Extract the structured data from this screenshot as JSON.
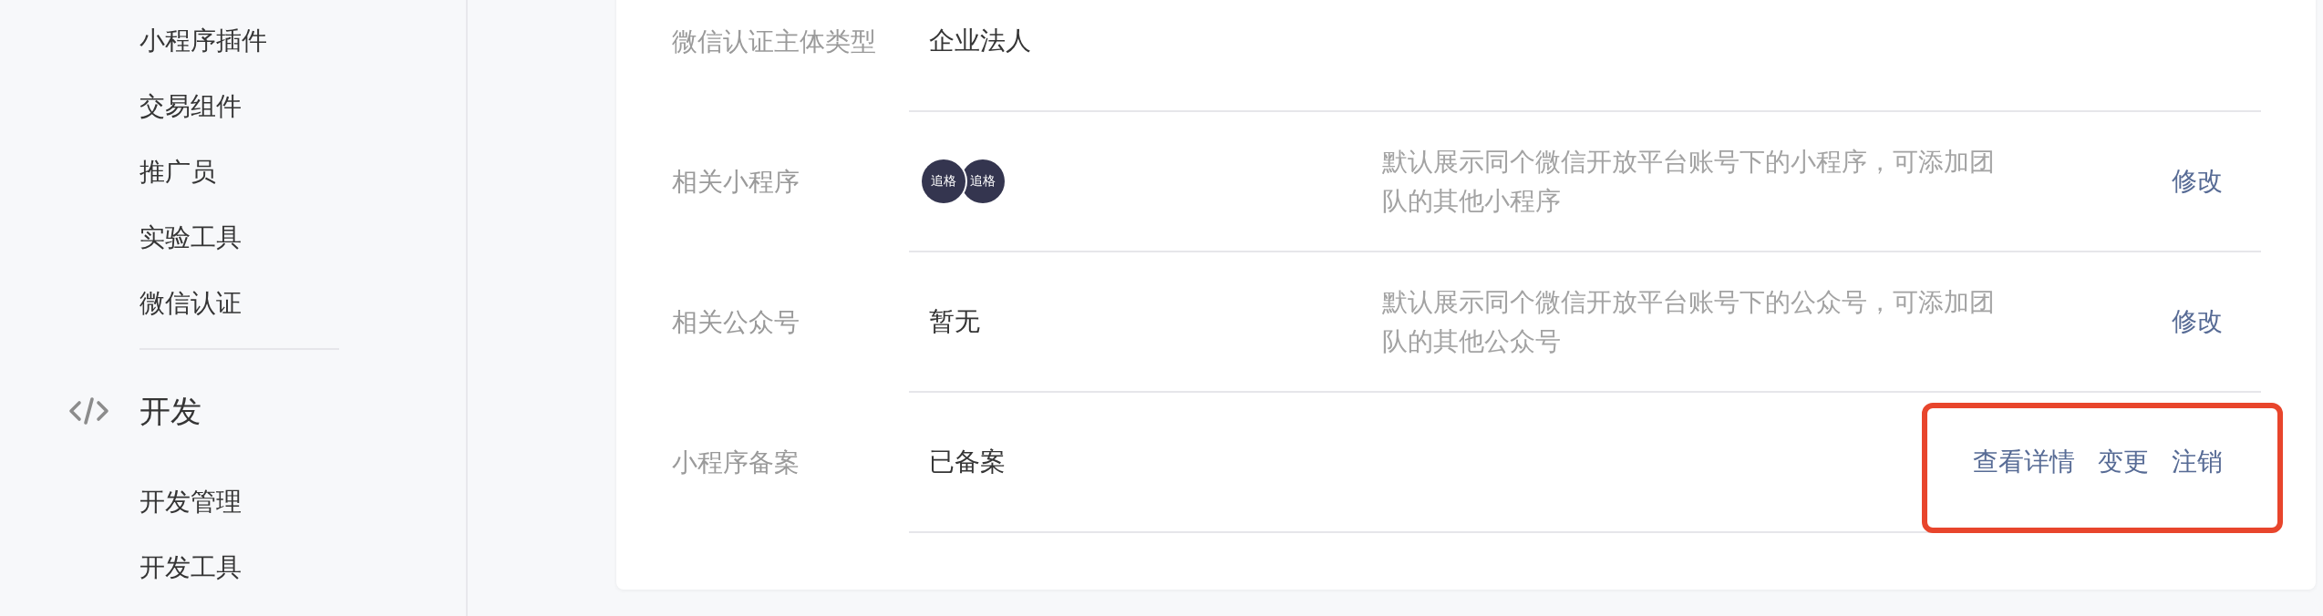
{
  "sidebar": {
    "groups": [
      {
        "items": [
          {
            "label": "小程序插件",
            "selected": false
          },
          {
            "label": "交易组件",
            "selected": false
          },
          {
            "label": "推广员",
            "selected": false
          },
          {
            "label": "实验工具",
            "selected": false
          },
          {
            "label": "微信认证",
            "selected": false
          }
        ]
      },
      {
        "title": "开发",
        "items": [
          {
            "label": "开发管理",
            "selected": false
          },
          {
            "label": "开发工具",
            "selected": false
          }
        ]
      }
    ]
  },
  "info_rows": [
    {
      "kind": "text",
      "label": "微信认证主体类型",
      "value": "企业法人",
      "actions_highlighted": false
    },
    {
      "kind": "avatars",
      "label": "相关小程序",
      "avatars": [
        "追格",
        "追格"
      ],
      "description": "默认展示同个微信开放平台账号下的小程序，可添加团队的其他小程序",
      "actions": [
        "修改"
      ],
      "actions_highlighted": false
    },
    {
      "kind": "text",
      "label": "相关公众号",
      "value": "暂无",
      "description": "默认展示同个微信开放平台账号下的公众号，可添加团队的其他公众号",
      "actions": [
        "修改"
      ],
      "actions_highlighted": false
    },
    {
      "kind": "text",
      "label": "小程序备案",
      "value": "已备案",
      "actions": [
        "查看详情",
        "变更",
        "注销"
      ],
      "actions_highlighted": true
    }
  ]
}
